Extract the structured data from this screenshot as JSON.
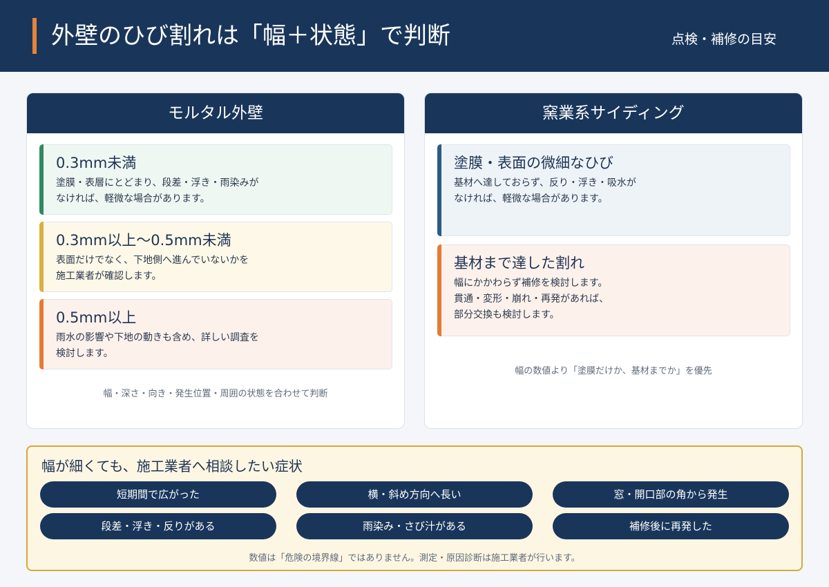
{
  "header": {
    "title": "外壁のひび割れは「幅＋状態」で判断",
    "subtitle": "点検・補修の目安"
  },
  "mortar": {
    "title": "モルタル外壁",
    "cards": [
      {
        "title": "0.3mm未満",
        "body": "塗膜・表層にとどまり、段差・浮き・雨染みが\nなければ、軽微な場合があります。"
      },
      {
        "title": "0.3mm以上〜0.5mm未満",
        "body": "表面だけでなく、下地側へ進んでいないかを\n施工業者が確認します。"
      },
      {
        "title": "0.5mm以上",
        "body": "雨水の影響や下地の動きも含め、詳しい調査を\n検討します。"
      }
    ],
    "note": "幅・深さ・向き・発生位置・周囲の状態を合わせて判断"
  },
  "siding": {
    "title": "窯業系サイディング",
    "cards": [
      {
        "title": "塗膜・表面の微細なひび",
        "body": "基材へ達しておらず、反り・浮き・吸水が\nなければ、軽微な場合があります。"
      },
      {
        "title": "基材まで達した割れ",
        "body": "幅にかかわらず補修を検討します。\n貫通・変形・崩れ・再発があれば、\n部分交換も検討します。"
      }
    ],
    "note": "幅の数値より「塗膜だけか、基材までか」を優先"
  },
  "consult": {
    "title": "幅が細くても、施工業者へ相談したい症状",
    "items": [
      "短期間で広がった",
      "横・斜め方向へ長い",
      "窓・開口部の角から発生",
      "段差・浮き・反りがある",
      "雨染み・さび汁がある",
      "補修後に再発した"
    ],
    "note": "数値は「危険の境界線」ではありません。測定・原因診断は施工業者が行います。"
  },
  "colors": {
    "navy": "#19365a",
    "accent_orange": "#e4843a",
    "green": "#2e8a62",
    "yellow": "#dbb040",
    "orange": "#e47b34",
    "blue": "#2b5b86"
  }
}
